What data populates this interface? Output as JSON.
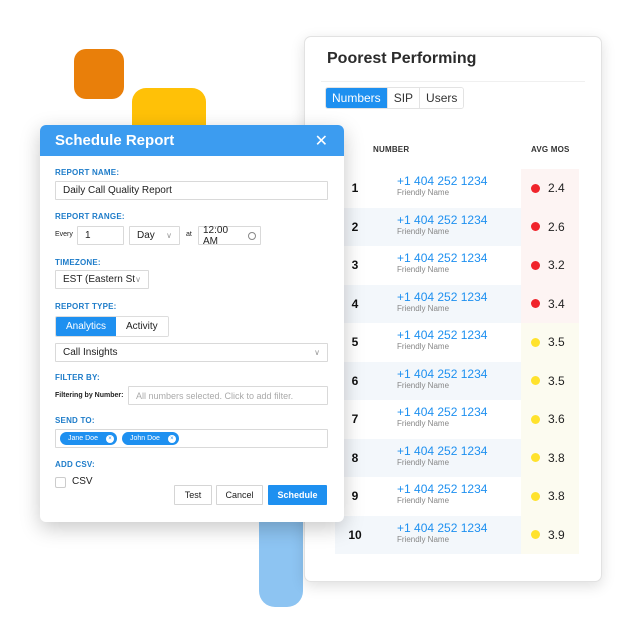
{
  "colors": {
    "accent": "#1E90F0",
    "modal_header": "#3C9CF0",
    "label_blue": "#1E7CC9",
    "mos_red": "#F0242B",
    "mos_yellow": "#FFE22D",
    "deco_orange": "#E97F0A",
    "deco_yellow": "#FFC107",
    "deco_blue": "#8DC4F2"
  },
  "card": {
    "title": "Poorest Performing",
    "tabs": [
      {
        "label": "Numbers",
        "active": true
      },
      {
        "label": "SIP",
        "active": false
      },
      {
        "label": "Users",
        "active": false
      }
    ],
    "columns": {
      "number": "NUMBER",
      "avg_mos": "AVG MOS"
    },
    "rows": [
      {
        "rank": "1",
        "phone": "+1 404 252 1234",
        "name": "Friendly Name",
        "mos": "2.4",
        "status": "red"
      },
      {
        "rank": "2",
        "phone": "+1 404 252 1234",
        "name": "Friendly Name",
        "mos": "2.6",
        "status": "red"
      },
      {
        "rank": "3",
        "phone": "+1 404 252 1234",
        "name": "Friendly Name",
        "mos": "3.2",
        "status": "red"
      },
      {
        "rank": "4",
        "phone": "+1 404 252 1234",
        "name": "Friendly Name",
        "mos": "3.4",
        "status": "red"
      },
      {
        "rank": "5",
        "phone": "+1 404 252 1234",
        "name": "Friendly Name",
        "mos": "3.5",
        "status": "yellow"
      },
      {
        "rank": "6",
        "phone": "+1 404 252 1234",
        "name": "Friendly Name",
        "mos": "3.5",
        "status": "yellow"
      },
      {
        "rank": "7",
        "phone": "+1 404 252 1234",
        "name": "Friendly Name",
        "mos": "3.6",
        "status": "yellow"
      },
      {
        "rank": "8",
        "phone": "+1 404 252 1234",
        "name": "Friendly Name",
        "mos": "3.8",
        "status": "yellow"
      },
      {
        "rank": "9",
        "phone": "+1 404 252 1234",
        "name": "Friendly Name",
        "mos": "3.8",
        "status": "yellow"
      },
      {
        "rank": "10",
        "phone": "+1 404 252 1234",
        "name": "Friendly Name",
        "mos": "3.9",
        "status": "yellow"
      }
    ]
  },
  "modal": {
    "title": "Schedule Report",
    "close_icon": "close-x",
    "report_name": {
      "label": "REPORT NAME:",
      "value": "Daily Call Quality Report"
    },
    "report_range": {
      "label": "REPORT RANGE:",
      "every_label": "Every",
      "every_value": "1",
      "period_value": "Day",
      "at_label": "at",
      "time_value": "12:00 AM"
    },
    "timezone": {
      "label": "TIMEZONE:",
      "value": "EST (Eastern Sta"
    },
    "report_type": {
      "label": "REPORT TYPE:",
      "options": [
        {
          "label": "Analytics",
          "active": true
        },
        {
          "label": "Activity",
          "active": false
        }
      ],
      "select_value": "Call Insights"
    },
    "filter_by": {
      "label": "FILTER BY:",
      "sub_label": "Filtering by Number:",
      "placeholder": "All numbers selected. Click to add filter."
    },
    "send_to": {
      "label": "SEND TO:",
      "recipients": [
        "Jane Doe",
        "John Doe"
      ]
    },
    "add_csv": {
      "label": "ADD CSV:",
      "checkbox_label": "CSV",
      "checked": false
    },
    "buttons": {
      "test": "Test",
      "cancel": "Cancel",
      "schedule": "Schedule"
    }
  }
}
